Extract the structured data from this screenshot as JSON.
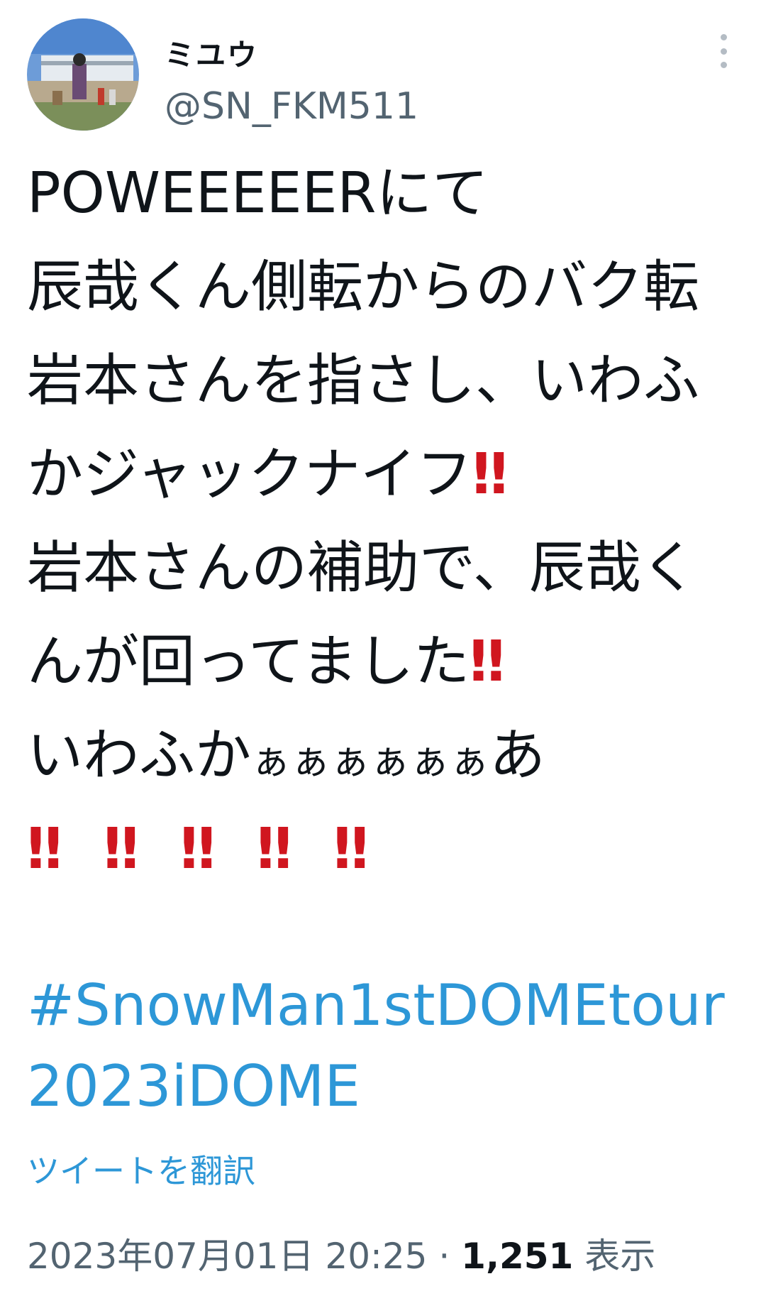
{
  "user": {
    "display_name": "ミユウ",
    "handle": "@SN_FKM511"
  },
  "tweet": {
    "lines": [
      "POWEEEEERにて",
      "辰哉くん側転からのバク転",
      "岩本さんを指さし、いわふ",
      "かジャックナイフ",
      "岩本さんの補助で、辰哉く",
      "んが回ってました",
      "いわふか",
      "ぁぁぁぁぁぁ",
      "あ"
    ],
    "emoji": "‼",
    "emoji_row": [
      "‼",
      "‼",
      "‼",
      "‼",
      "‼"
    ],
    "hashtag": "#SnowMan1stDOMEtour2023iDOME",
    "translate_label": "ツイートを翻訳"
  },
  "meta": {
    "timestamp": "2023年07月01日 20:25",
    "separator": " · ",
    "views": "1,251",
    "views_label": " 表示"
  },
  "colors": {
    "link": "#2d97d7",
    "emoji": "#d0161f",
    "secondary": "#536471"
  },
  "icons": {
    "more": "more-vertical-icon"
  }
}
